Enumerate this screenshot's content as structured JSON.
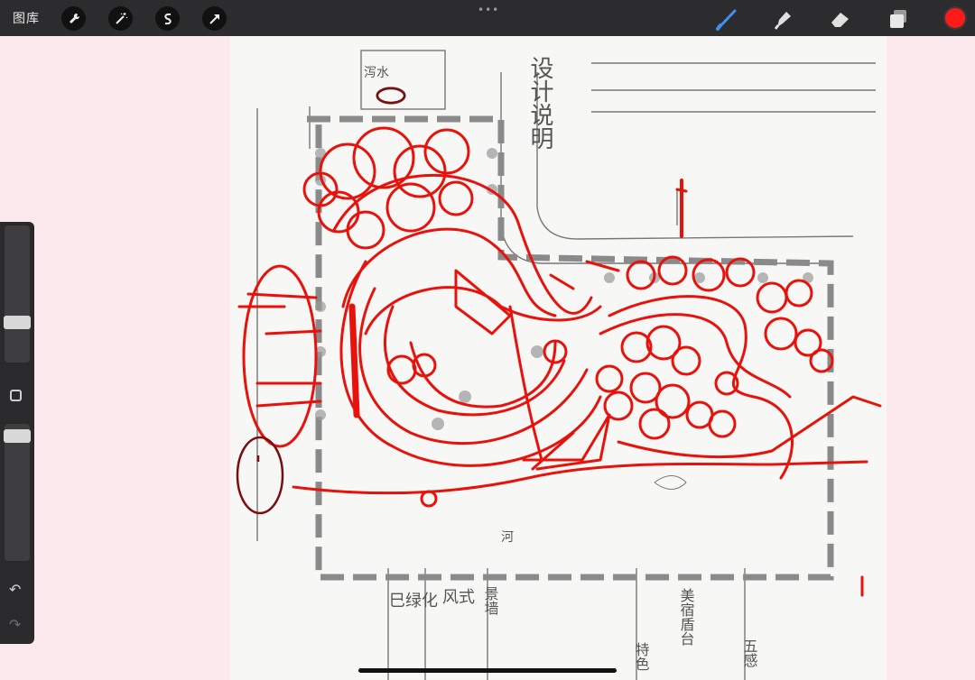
{
  "toolbar": {
    "gallery_label": "图库",
    "more_dots": "•••",
    "left_tools": [
      {
        "name": "wrench-icon"
      },
      {
        "name": "magic-wand-icon"
      },
      {
        "name": "selection-icon"
      },
      {
        "name": "transform-arrow-icon"
      }
    ],
    "right_tools": [
      {
        "name": "brush-icon"
      },
      {
        "name": "smudge-icon"
      },
      {
        "name": "eraser-icon"
      },
      {
        "name": "layers-icon"
      }
    ],
    "current_color": "#ff1a1a"
  },
  "sidebar": {
    "size_slider_level": 0.7,
    "opacity_slider_level": 0.9,
    "undo_icon": "undo-icon",
    "redo_icon": "redo-icon"
  },
  "sketch": {
    "design_notes_title": "设计说明",
    "water_label": "泻水",
    "river_label": "河",
    "plant_label": "巳绿化",
    "style_label": "风式",
    "view_label": "景墙",
    "seat_label": "美宿盾台",
    "feature_label": "特色",
    "five_label": "五感"
  },
  "colors": {
    "ink_red": "#e8120c",
    "pencil": "#6a6a6a"
  }
}
